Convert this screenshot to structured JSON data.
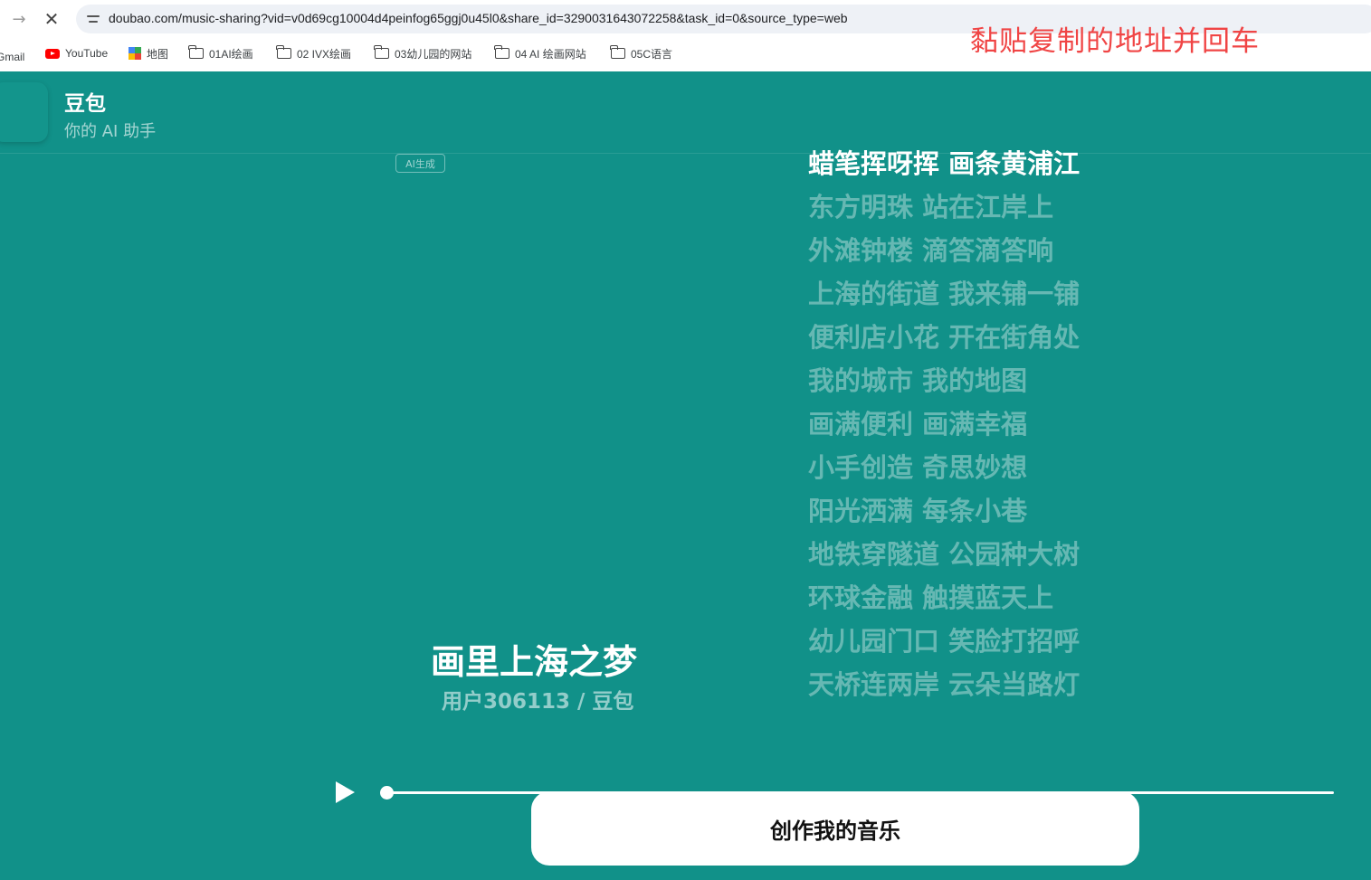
{
  "browser": {
    "url": "doubao.com/music-sharing?vid=v0d69cg10004d4peinfog65ggj0u45l0&share_id=3290031643072258&task_id=0&source_type=web",
    "overlay_note": "黏贴复制的地址并回车",
    "bookmarks": {
      "gmail": "Gmail",
      "youtube": "YouTube",
      "map": "地图",
      "f1": "01AI绘画",
      "f2": "02 IVX绘画",
      "f3": "03幼儿园的网站",
      "f4": "04 AI 绘画网站",
      "f5": "05C语言"
    }
  },
  "app": {
    "name": "豆包",
    "tagline": "你的 AI 助手",
    "ai_badge": "AI生成"
  },
  "song": {
    "title": "画里上海之梦",
    "artist": "用户306113 / 豆包",
    "progress": 0
  },
  "lyrics": [
    "蜡笔挥呀挥 画条黄浦江",
    "东方明珠 站在江岸上",
    "外滩钟楼 滴答滴答响",
    "上海的街道 我来铺一铺",
    "便利店小花 开在街角处",
    "我的城市 我的地图",
    "画满便利 画满幸福",
    "小手创造 奇思妙想",
    "阳光洒满 每条小巷",
    "地铁穿隧道 公园种大树",
    "环球金融 触摸蓝天上",
    "幼儿园门口 笑脸打招呼",
    "天桥连两岸 云朵当路灯"
  ],
  "active_lyric_index": 0,
  "cta": {
    "label": "创作我的音乐"
  },
  "icons": {
    "back": "arrow-right-icon",
    "stop": "close-icon",
    "site_info": "tune-icon",
    "play": "play-icon"
  },
  "colors": {
    "background": "#119189",
    "overlay_note": "#f04545",
    "cta_background": "#ffffff"
  }
}
